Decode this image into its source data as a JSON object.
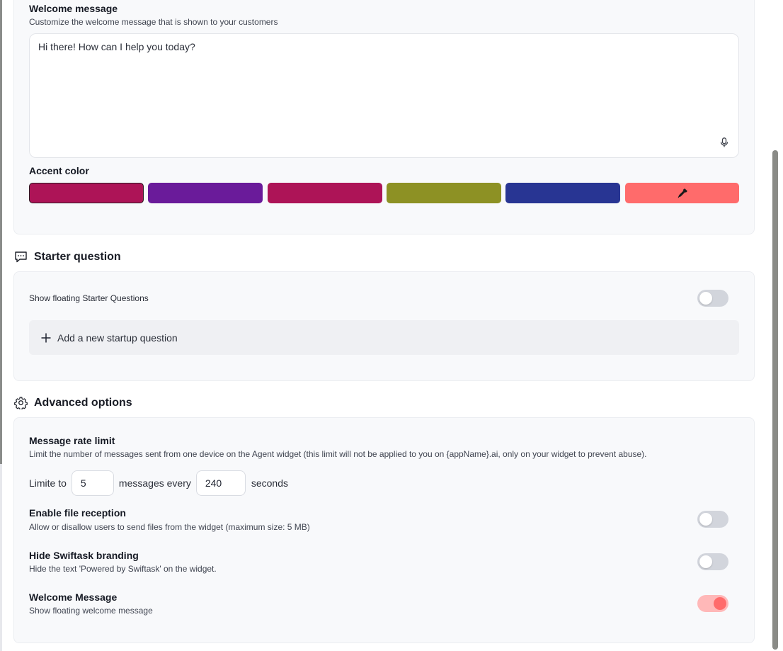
{
  "welcome": {
    "title": "Welcome message",
    "description": "Customize the welcome message that is shown to your customers",
    "value": "Hi there! How can I help you today?"
  },
  "accent": {
    "title": "Accent color",
    "colors": [
      "#ad1457",
      "#6a1b9a",
      "#ad1457",
      "#8d9124",
      "#283593",
      "#ff6b6b"
    ],
    "selected_index": 0,
    "custom_icon": "eyedropper-icon"
  },
  "starter": {
    "heading": "Starter question",
    "heading_icon": "chat-bubble-icon",
    "show_label": "Show floating Starter Questions",
    "show_enabled": false,
    "add_label": "Add a new startup question"
  },
  "advanced": {
    "heading": "Advanced options",
    "heading_icon": "gear-icon",
    "rate": {
      "title": "Message rate limit",
      "description": "Limit the number of messages sent from one device on the Agent widget (this limit will not be applied to you on {appName}.ai, only on your widget to prevent abuse).",
      "prefix": "Limite to",
      "messages_value": "5",
      "middle": "messages every",
      "seconds_value": "240",
      "suffix": "seconds"
    },
    "file": {
      "title": "Enable file reception",
      "description": "Allow or disallow users to send files from the widget (maximum size: 5 MB)",
      "enabled": false
    },
    "branding": {
      "title": "Hide Swiftask branding",
      "description": "Hide the text 'Powered by Swiftask' on the widget.",
      "enabled": false
    },
    "welcome_toggle": {
      "title": "Welcome Message",
      "description": "Show floating welcome message",
      "enabled": true
    }
  }
}
